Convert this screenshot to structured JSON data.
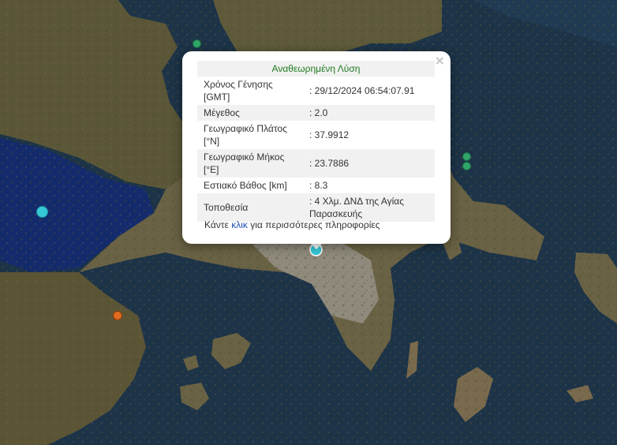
{
  "popup": {
    "title": "Αναθεωρημένη Λύση",
    "rows": [
      {
        "label": "Χρόνος Γένησης [GMT]",
        "value": ": 29/12/2024 06:54:07.91"
      },
      {
        "label": "Μέγεθος",
        "value": ": 2.0"
      },
      {
        "label": "Γεωγραφικό Πλάτος [°N]",
        "value": ": 37.9912"
      },
      {
        "label": "Γεωγραφικό Μήκος [°E]",
        "value": ": 23.7886"
      },
      {
        "label": "Εστιακό Βάθος [km]",
        "value": ": 8.3"
      },
      {
        "label": "Τοποθεσία",
        "value": ": 4 Χλμ. ΔΝΔ της Αγίας Παρασκευής"
      }
    ],
    "more_prefix": "Κάντε ",
    "more_link": "κλικ",
    "more_suffix": " για περισσότερες πληροφορίες",
    "close_glyph": "×"
  },
  "colors": {
    "sea": "#1c3348",
    "land": "#5c5a3a",
    "marker_green": "#2fa56a",
    "marker_cyan": "#36c8d6",
    "marker_orange": "#e06a1f",
    "title_green": "#1f7a1f",
    "link": "#1f4fb3"
  },
  "icons": {
    "close": "close-icon",
    "selected_event": "map-pin-icon"
  }
}
